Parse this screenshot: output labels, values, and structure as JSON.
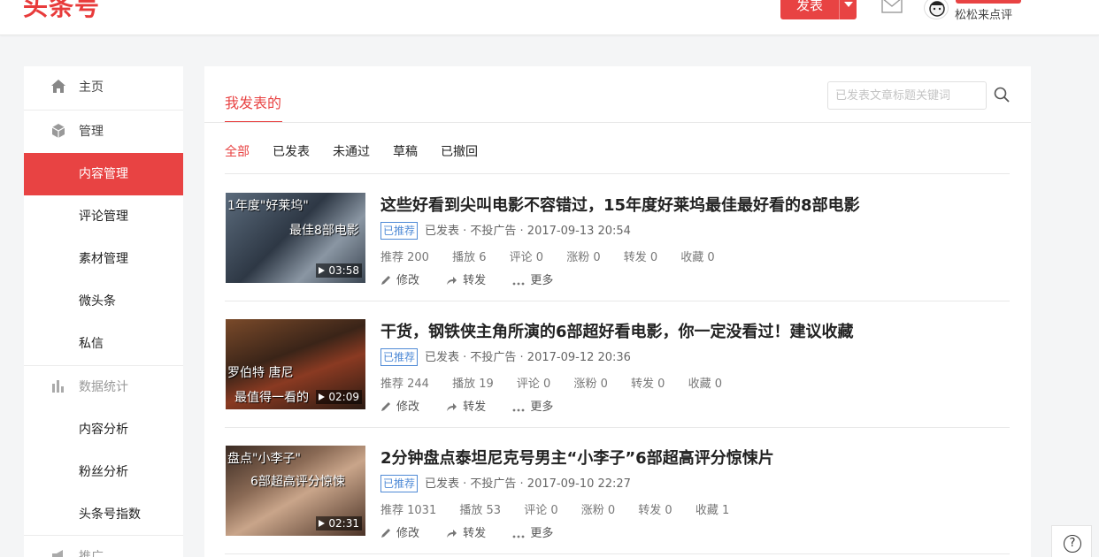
{
  "header": {
    "logo": "头条号",
    "publish_label": "发表",
    "user_name": "松松来点评"
  },
  "sidebar": {
    "items": [
      {
        "label": "主页",
        "icon": "home-icon"
      },
      {
        "label": "管理",
        "icon": "cube-icon"
      },
      {
        "label": "内容管理"
      },
      {
        "label": "评论管理"
      },
      {
        "label": "素材管理"
      },
      {
        "label": "微头条"
      },
      {
        "label": "私信"
      },
      {
        "label": "数据统计",
        "icon": "bar-chart-icon"
      },
      {
        "label": "内容分析"
      },
      {
        "label": "粉丝分析"
      },
      {
        "label": "头条号指数"
      },
      {
        "label": "推广",
        "icon": "megaphone-icon"
      }
    ]
  },
  "main": {
    "title": "我发表的",
    "search_placeholder": "已发表文章标题关键词",
    "tabs": [
      "全部",
      "已发表",
      "未通过",
      "草稿",
      "已撤回"
    ],
    "articles": [
      {
        "title": "这些好看到尖叫电影不容错过，15年度好莱坞最佳最好看的8部电影",
        "badge": "已推荐",
        "status": "已发表 · 不投广告 · 2017-09-13 20:54",
        "stats": [
          "推荐 200",
          "播放 6",
          "评论 0",
          "涨粉 0",
          "转发 0",
          "收藏 0"
        ],
        "thumb_caption_1": "1年度\"好莱坞\"",
        "thumb_caption_2": "最佳8部电影",
        "duration": "03:58"
      },
      {
        "title": "干货，钢铁侠主角所演的6部超好看电影，你一定没看过！建议收藏",
        "badge": "已推荐",
        "status": "已发表 · 不投广告 · 2017-09-12 20:36",
        "stats": [
          "推荐 244",
          "播放 19",
          "评论 0",
          "涨粉 0",
          "转发 0",
          "收藏 0"
        ],
        "thumb_caption_1": "罗伯特 唐尼",
        "thumb_caption_2": "最值得一看的",
        "duration": "02:09"
      },
      {
        "title": "2分钟盘点泰坦尼克号男主“小李子”6部超高评分惊悚片",
        "badge": "已推荐",
        "status": "已发表 · 不投广告 · 2017-09-10 22:27",
        "stats": [
          "推荐 1031",
          "播放 53",
          "评论 0",
          "涨粉 0",
          "转发 0",
          "收藏 1"
        ],
        "thumb_caption_1": "盘点\"小李子\"",
        "thumb_caption_2": "6部超高评分惊悚",
        "duration": "02:31"
      }
    ],
    "actions": {
      "edit": "修改",
      "share": "转发",
      "more": "更多"
    }
  },
  "help": {
    "label": "?"
  },
  "colors": {
    "accent": "#e84343",
    "badge_blue": "#4f8ad6"
  }
}
